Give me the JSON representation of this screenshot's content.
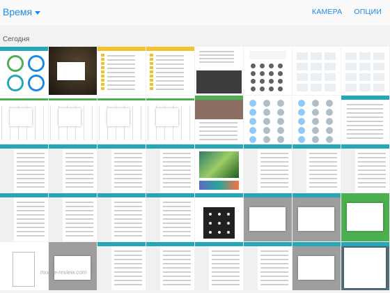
{
  "header": {
    "title": "Время",
    "camera": "КАМЕРА",
    "options": "ОПЦИИ"
  },
  "section": {
    "today": "Сегодня"
  },
  "watermark": "mobile-review.com",
  "colors": {
    "accent": "#1e88e5",
    "teal": "#26a7b8",
    "green": "#4caf50",
    "yellow": "#f2c12e"
  },
  "thumbnails": [
    {
      "kind": "storage",
      "bar": "teal"
    },
    {
      "kind": "dialog-dark",
      "bar": "none"
    },
    {
      "kind": "filelist",
      "bar": "yellow"
    },
    {
      "kind": "filelist",
      "bar": "yellow"
    },
    {
      "kind": "keyboard",
      "bar": "none"
    },
    {
      "kind": "calculator",
      "bar": "none"
    },
    {
      "kind": "calendar",
      "bar": "none"
    },
    {
      "kind": "calendar",
      "bar": "none"
    },
    {
      "kind": "timeline",
      "bar": "none"
    },
    {
      "kind": "timeline",
      "bar": "none"
    },
    {
      "kind": "timeline",
      "bar": "none"
    },
    {
      "kind": "timeline",
      "bar": "none"
    },
    {
      "kind": "photo-list",
      "bar": "green"
    },
    {
      "kind": "contacts",
      "bar": "none"
    },
    {
      "kind": "contacts",
      "bar": "none"
    },
    {
      "kind": "list",
      "bar": "teal"
    },
    {
      "kind": "settings",
      "bar": "teal"
    },
    {
      "kind": "settings",
      "bar": "teal"
    },
    {
      "kind": "settings",
      "bar": "teal"
    },
    {
      "kind": "settings",
      "bar": "teal"
    },
    {
      "kind": "wallpaper",
      "bar": "teal"
    },
    {
      "kind": "settings",
      "bar": "teal"
    },
    {
      "kind": "settings",
      "bar": "teal"
    },
    {
      "kind": "settings",
      "bar": "teal"
    },
    {
      "kind": "settings",
      "bar": "teal"
    },
    {
      "kind": "settings",
      "bar": "teal"
    },
    {
      "kind": "settings",
      "bar": "teal"
    },
    {
      "kind": "settings",
      "bar": "teal"
    },
    {
      "kind": "pattern",
      "bar": "teal"
    },
    {
      "kind": "dialog-light",
      "bar": "teal"
    },
    {
      "kind": "dialog-light",
      "bar": "teal"
    },
    {
      "kind": "dialog-green",
      "bar": "green"
    },
    {
      "kind": "hand",
      "bar": "none"
    },
    {
      "kind": "dialog-light",
      "bar": "none"
    },
    {
      "kind": "settings",
      "bar": "teal"
    },
    {
      "kind": "settings",
      "bar": "teal"
    },
    {
      "kind": "settings",
      "bar": "teal"
    },
    {
      "kind": "settings",
      "bar": "teal"
    },
    {
      "kind": "dialog-light",
      "bar": "teal"
    },
    {
      "kind": "apps-dialog",
      "bar": "teal"
    }
  ]
}
